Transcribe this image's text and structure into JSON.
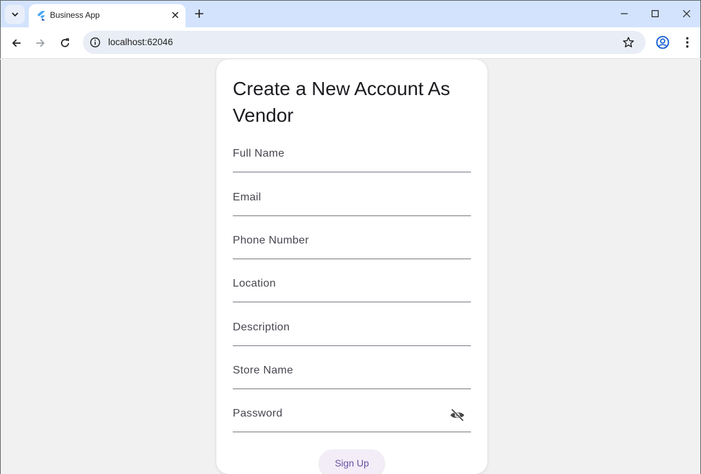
{
  "browser": {
    "tab_title": "Business App",
    "url": "localhost:62046",
    "icons": {
      "tab_search": "chevron-down-icon",
      "tab_close": "close-icon",
      "new_tab": "plus-icon",
      "back": "arrow-left-icon",
      "forward": "arrow-right-icon",
      "reload": "reload-icon",
      "site_info": "info-icon",
      "bookmark": "star-icon",
      "profile": "profile-icon",
      "menu": "kebab-menu-icon",
      "minimize": "minimize-icon",
      "maximize": "maximize-icon",
      "close_window": "close-icon"
    }
  },
  "form": {
    "title": "Create a New Account As Vendor",
    "fields": {
      "full_name": "Full Name",
      "email": "Email",
      "phone": "Phone Number",
      "location": "Location",
      "description": "Description",
      "store_name": "Store Name",
      "password": "Password"
    },
    "password_visibility_icon": "eye-off-icon",
    "submit_label": "Sign Up"
  },
  "colors": {
    "tabbar_bg": "#d3e3fd",
    "page_bg": "#f1f1f1",
    "card_bg": "#ffffff",
    "field_underline": "#79747e",
    "button_bg": "#f3edf7",
    "button_text": "#6750a4"
  }
}
